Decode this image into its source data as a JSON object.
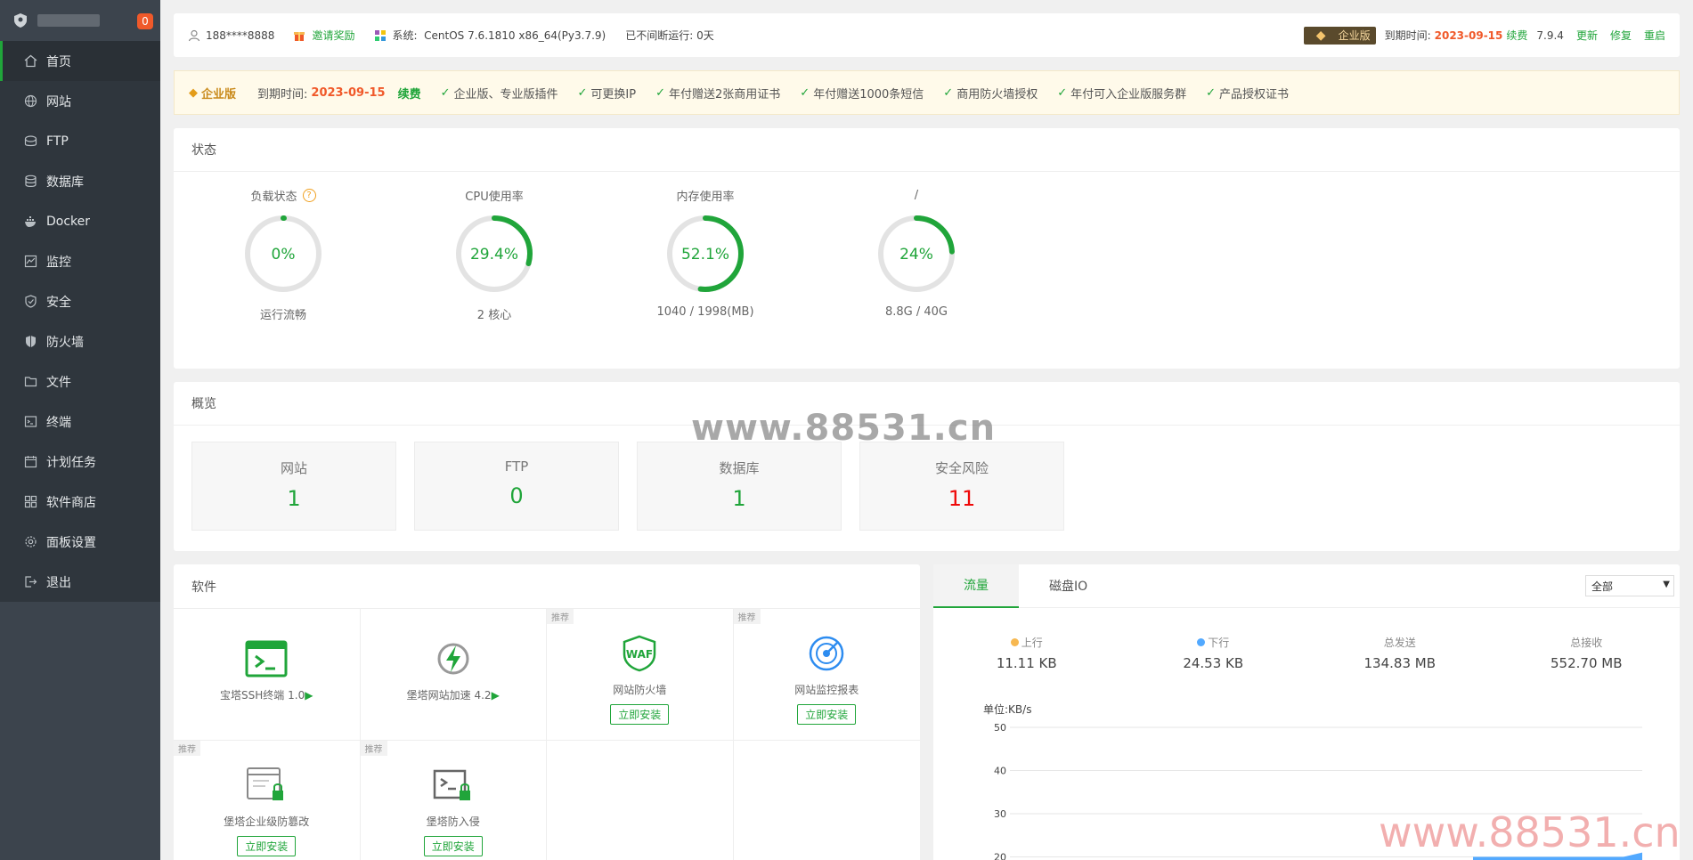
{
  "sidebar": {
    "badge": "0",
    "items": [
      {
        "label": "首页",
        "icon": "home-icon",
        "active": true
      },
      {
        "label": "网站",
        "icon": "globe-icon"
      },
      {
        "label": "FTP",
        "icon": "ftp-icon"
      },
      {
        "label": "数据库",
        "icon": "database-icon"
      },
      {
        "label": "Docker",
        "icon": "docker-icon"
      },
      {
        "label": "监控",
        "icon": "monitor-icon"
      },
      {
        "label": "安全",
        "icon": "shield-icon"
      },
      {
        "label": "防火墙",
        "icon": "firewall-icon"
      },
      {
        "label": "文件",
        "icon": "folder-icon"
      },
      {
        "label": "终端",
        "icon": "terminal-icon"
      },
      {
        "label": "计划任务",
        "icon": "calendar-icon"
      },
      {
        "label": "软件商店",
        "icon": "apps-icon"
      },
      {
        "label": "面板设置",
        "icon": "gear-icon"
      },
      {
        "label": "退出",
        "icon": "logout-icon"
      }
    ]
  },
  "topbar": {
    "user": "188****8888",
    "invite": "邀请奖励",
    "system_label": "系统:",
    "system": "CentOS 7.6.1810 x86_64(Py3.7.9)",
    "uptime": "已不间断运行: 0天",
    "edition": "企业版",
    "expire_label": "到期时间:",
    "expire_date": "2023-09-15",
    "renew": "续费",
    "version": "7.9.4",
    "update": "更新",
    "repair": "修复",
    "restart": "重启"
  },
  "promo": {
    "edition": "企业版",
    "expire_label": "到期时间:",
    "expire_date": "2023-09-15",
    "renew": "续费",
    "features": [
      "企业版、专业版插件",
      "可更换IP",
      "年付赠送2张商用证书",
      "年付赠送1000条短信",
      "商用防火墙授权",
      "年付可入企业版服务群",
      "产品授权证书"
    ]
  },
  "status": {
    "title": "状态",
    "gauges": [
      {
        "title": "负载状态",
        "value": "0%",
        "percent": 0,
        "sub": "运行流畅",
        "help": "?"
      },
      {
        "title": "CPU使用率",
        "value": "29.4%",
        "percent": 29.4,
        "sub": "2 核心"
      },
      {
        "title": "内存使用率",
        "value": "52.1%",
        "percent": 52.1,
        "sub": "1040 / 1998(MB)"
      },
      {
        "title": "/",
        "value": "24%",
        "percent": 24,
        "sub": "8.8G / 40G"
      }
    ]
  },
  "overview": {
    "title": "概览",
    "cards": [
      {
        "title": "网站",
        "value": "1",
        "color": "#20a53a"
      },
      {
        "title": "FTP",
        "value": "0",
        "color": "#20a53a"
      },
      {
        "title": "数据库",
        "value": "1",
        "color": "#20a53a"
      },
      {
        "title": "安全风险",
        "value": "11",
        "color": "#ef0808"
      }
    ]
  },
  "software": {
    "title": "软件",
    "items": [
      {
        "name": "宝塔SSH终端 1.0",
        "play": "▶",
        "icon": "ssh-terminal-icon",
        "tag": "",
        "button": ""
      },
      {
        "name": "堡塔网站加速 4.2",
        "play": "▶",
        "icon": "lightning-icon",
        "tag": "",
        "button": ""
      },
      {
        "name": "网站防火墙",
        "play": "",
        "icon": "waf-icon",
        "tag": "推荐",
        "button": "立即安装"
      },
      {
        "name": "网站监控报表",
        "play": "",
        "icon": "radar-icon",
        "tag": "推荐",
        "button": "立即安装"
      },
      {
        "name": "堡塔企业级防篡改",
        "play": "",
        "icon": "tamper-lock-icon",
        "tag": "推荐",
        "button": "立即安装"
      },
      {
        "name": "堡塔防入侵",
        "play": "",
        "icon": "intrusion-lock-icon",
        "tag": "推荐",
        "button": "立即安装"
      },
      {
        "name": "",
        "play": "",
        "icon": "",
        "tag": "",
        "button": ""
      },
      {
        "name": "",
        "play": "",
        "icon": "",
        "tag": "",
        "button": ""
      }
    ]
  },
  "traffic": {
    "tabs": [
      "流量",
      "磁盘IO"
    ],
    "select": "全部",
    "stats": [
      {
        "label": "上行",
        "value": "11.11 KB",
        "dot": "#f7b851"
      },
      {
        "label": "下行",
        "value": "24.53 KB",
        "dot": "#52a9ff"
      },
      {
        "label": "总发送",
        "value": "134.83 MB",
        "dot": ""
      },
      {
        "label": "总接收",
        "value": "552.70 MB",
        "dot": ""
      }
    ],
    "unit": "单位:KB/s"
  },
  "chart_data": {
    "type": "area",
    "ylabel": "单位:KB/s",
    "y_ticks": [
      50,
      40,
      30,
      20
    ],
    "ylim": [
      20,
      50
    ],
    "series": [
      {
        "values": [
          20,
          20,
          20,
          20,
          20,
          20,
          20,
          20,
          20,
          21
        ]
      }
    ]
  },
  "watermark": "www.88531.cn",
  "watermark2": "www.88531.cn"
}
